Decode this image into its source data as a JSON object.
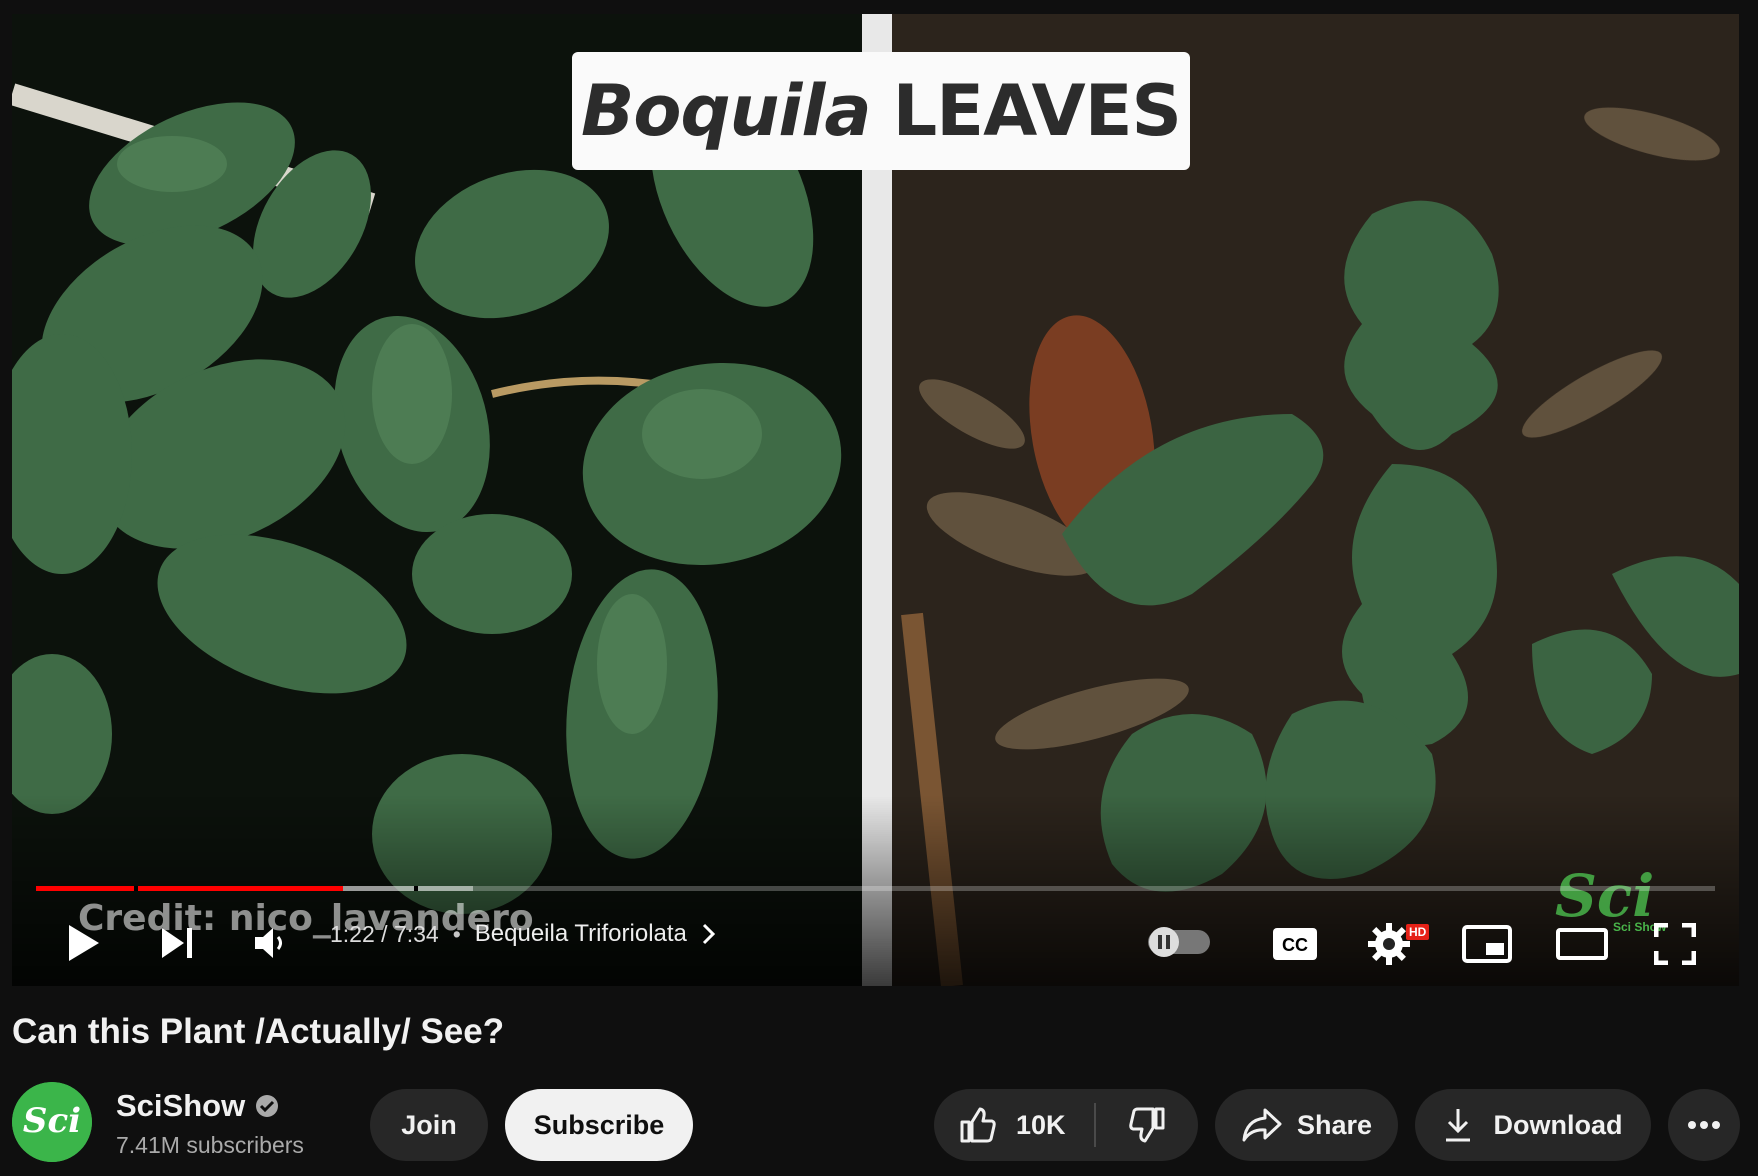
{
  "player": {
    "overlay_title_italic": "Boquila",
    "overlay_title_bold": "LEAVES",
    "credit": "Credit: nico_lavandero",
    "watermark": "Sci Show",
    "progress_fraction": 0.183,
    "buffered_fraction": 0.26,
    "current_time": "1:22",
    "duration": "7:34",
    "time_separator": "/",
    "chapter_separator": "•",
    "chapter": "Bequeila Triforiolata",
    "hd_badge": "HD",
    "cc_label": "CC",
    "accent": "#ff0000"
  },
  "video": {
    "title": "Can this Plant /Actually/ See?"
  },
  "channel": {
    "name": "SciShow",
    "subscribers": "7.41M subscribers",
    "avatar_text": "Sci",
    "avatar_color": "#3bb54a"
  },
  "actions": {
    "join": "Join",
    "subscribe": "Subscribe",
    "likes": "10K",
    "share": "Share",
    "download": "Download"
  },
  "icons": [
    "play-icon",
    "next-icon",
    "volume-icon",
    "autoplay-toggle-icon",
    "cc-icon",
    "settings-icon",
    "miniplayer-icon",
    "theater-icon",
    "fullscreen-icon",
    "verified-icon",
    "like-icon",
    "dislike-icon",
    "share-icon",
    "download-icon",
    "more-icon",
    "chevron-right-icon"
  ]
}
